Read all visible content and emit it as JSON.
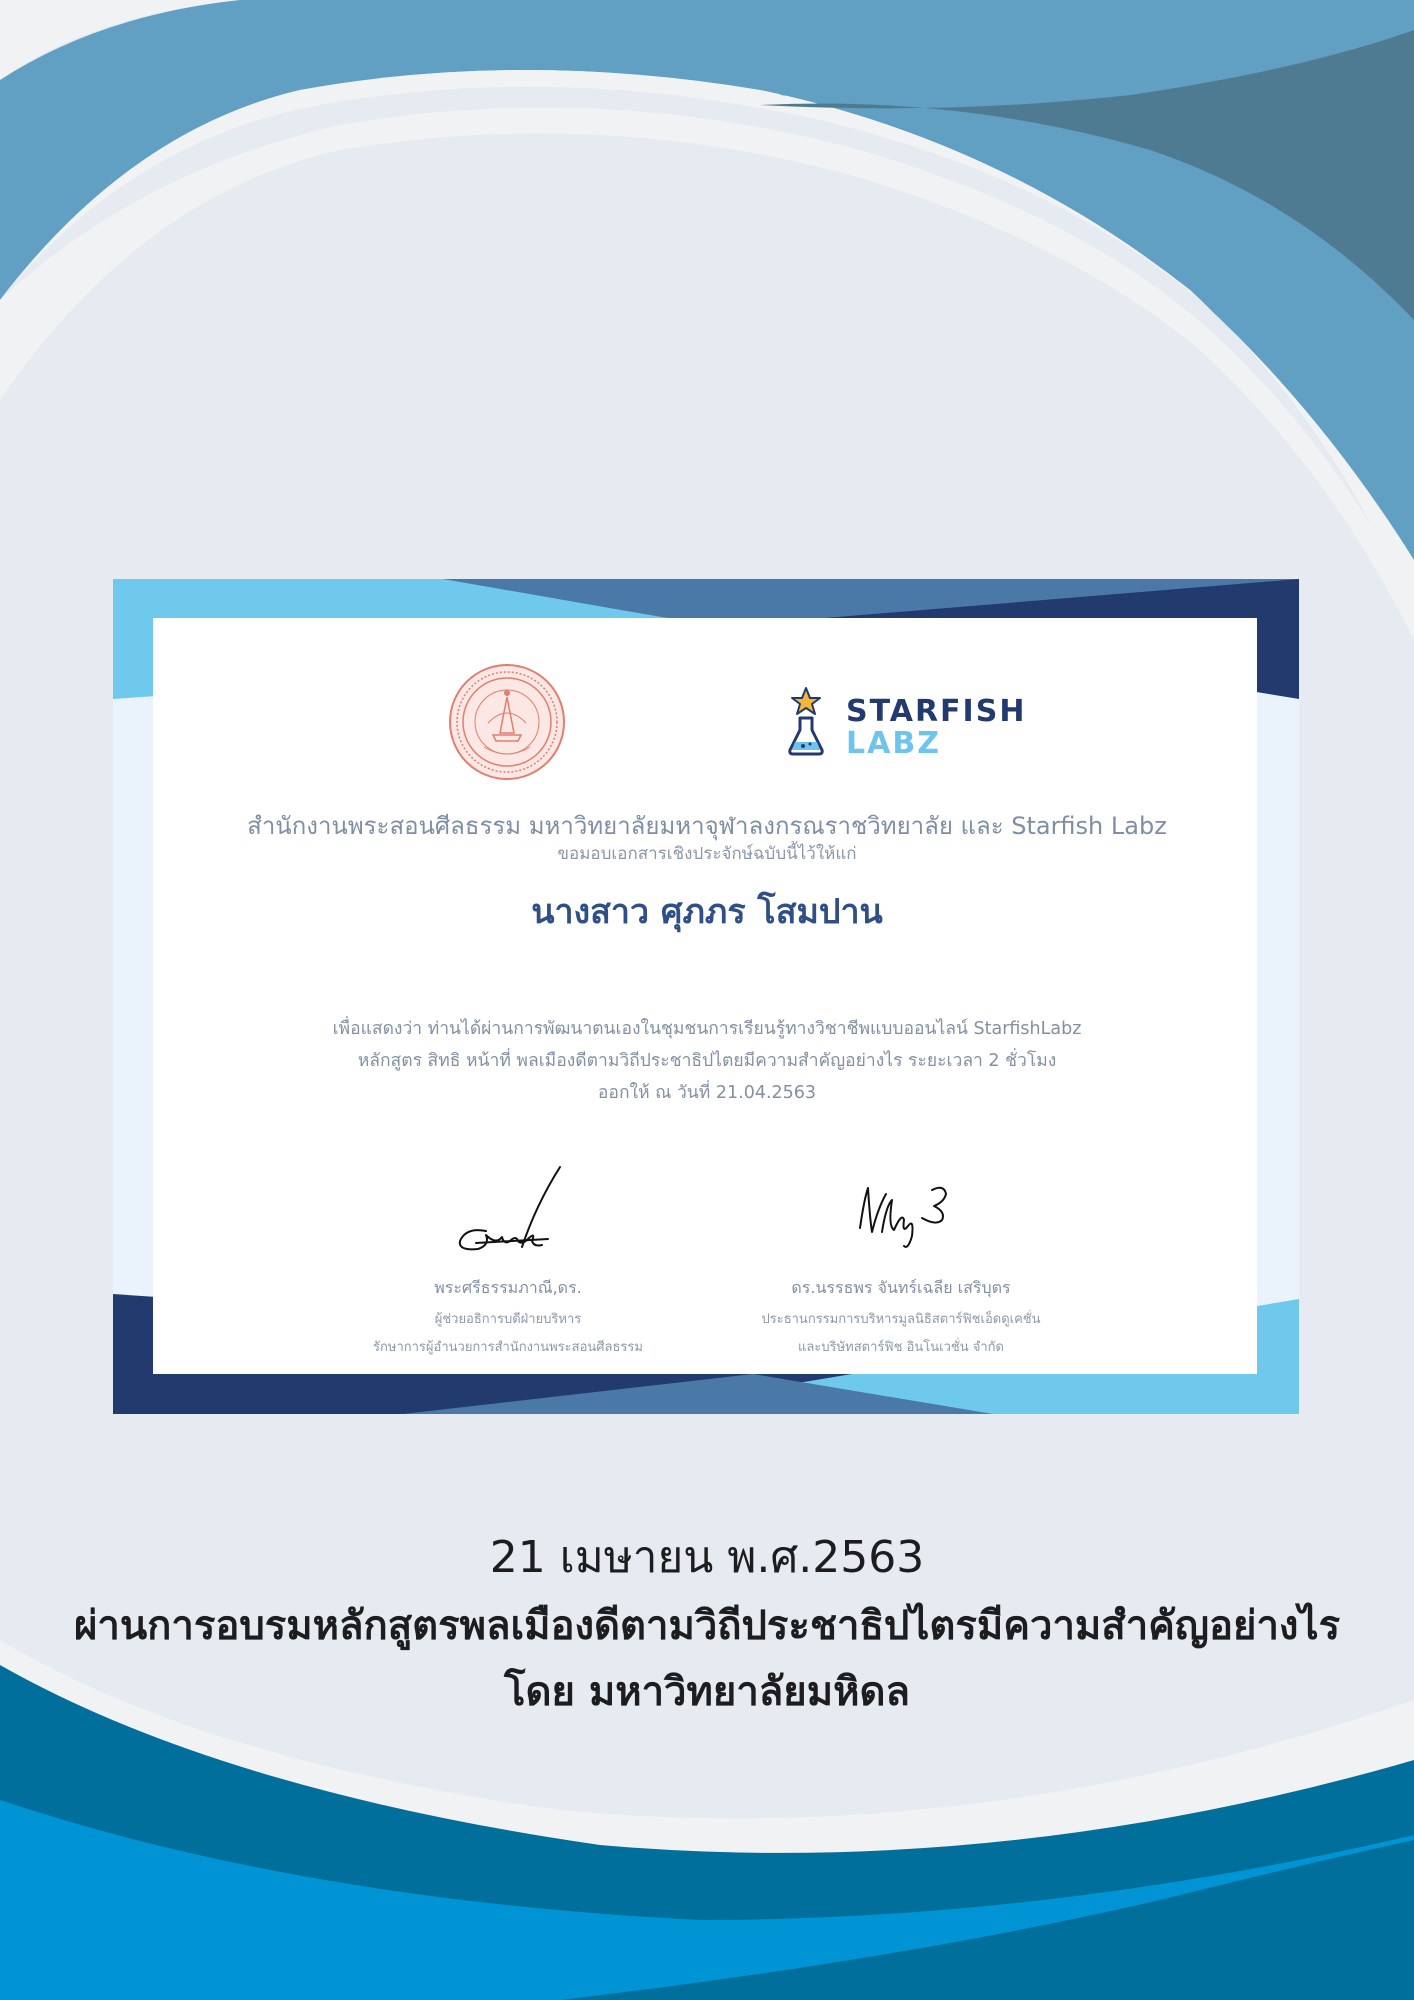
{
  "colors": {
    "page_background": "#e6ebf1",
    "wave_light_blue": "#62a0c3",
    "wave_slate": "#4f7b92",
    "wave_bright_blue": "#0094d4",
    "wave_deep_blue": "#006f9c",
    "frame_navy": "#233a6f",
    "frame_sky": "#6ec9ec",
    "recipient_text": "#2f4f86"
  },
  "certificate": {
    "logos": {
      "left": "university-seal",
      "right": "starfish-labz-logo",
      "right_wordmark_line1": "STARFISH",
      "right_wordmark_line2": "LABZ"
    },
    "issuer": "สำนักงานพระสอนศีลธรรม มหาวิทยาลัยมหาจุฬาลงกรณราชวิทยาลัย และ Starfish Labz",
    "presents_line": "ขอมอบเอกสารเชิงประจักษ์ฉบับนี้ไว้ให้แก่",
    "recipient": "นางสาว ศุภภร โสมปาน",
    "body": [
      "เพื่อแสดงว่า ท่านได้ผ่านการพัฒนาตนเองในชุมชนการเรียนรู้ทางวิชาชีพแบบออนไลน์ StarfishLabz",
      "หลักสูตร สิทธิ หน้าที่ พลเมืองดีตามวิถีประชาธิปไตยมีความสำคัญอย่างไร ระยะเวลา 2 ชั่วโมง",
      "ออกให้ ณ วันที่ 21.04.2563"
    ],
    "signatories": [
      {
        "name": "พระศรีธรรมภาณี,ดร.",
        "role_line1": "ผู้ช่วยอธิการบดีฝ่ายบริหาร",
        "role_line2": "รักษาการผู้อำนวยการสำนักงานพระสอนศีลธรรม"
      },
      {
        "name": "ดร.นรรธพร จันทร์เฉลีย เสริบุตร",
        "role_line1": "ประธานกรรมการบริหารมูลนิธิสตาร์ฟิชเอ็ดดูเคชั่น",
        "role_line2": "และบริษัทสตาร์ฟิช อินโนเวชั่น จำกัด"
      }
    ]
  },
  "caption": {
    "date": "21 เมษายน พ.ศ.2563",
    "course": "ผ่านการอบรมหลักสูตรพลเมืองดีตามวิถีประชาธิปไตรมีความสำคัญอย่างไร",
    "provider": "โดย มหาวิทยาลัยมหิดล"
  }
}
